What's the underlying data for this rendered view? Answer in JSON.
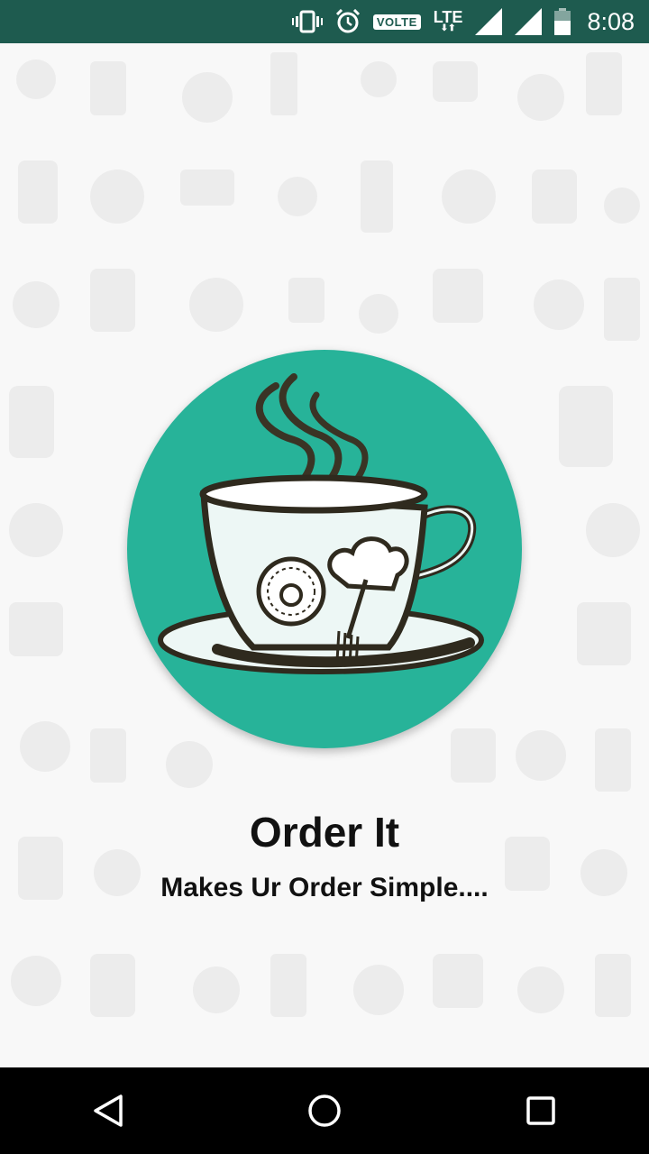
{
  "status_bar": {
    "volte_label": "VOLTE",
    "network_label": "LTE",
    "time": "8:08",
    "icons": [
      "vibrate-icon",
      "alarm-icon",
      "volte-badge",
      "lte-icon",
      "signal-icon",
      "signal-icon",
      "battery-icon"
    ]
  },
  "splash": {
    "title": "Order It",
    "tagline": "Makes Ur Order Simple....",
    "logo": "coffee-cup-logo"
  },
  "colors": {
    "status_bar": "#1e5b4f",
    "logo_circle": "#27b399",
    "background": "#f8f8f8",
    "nav_bar": "#000000"
  },
  "navigation": {
    "buttons": [
      "back-icon",
      "home-icon",
      "recents-icon"
    ]
  }
}
